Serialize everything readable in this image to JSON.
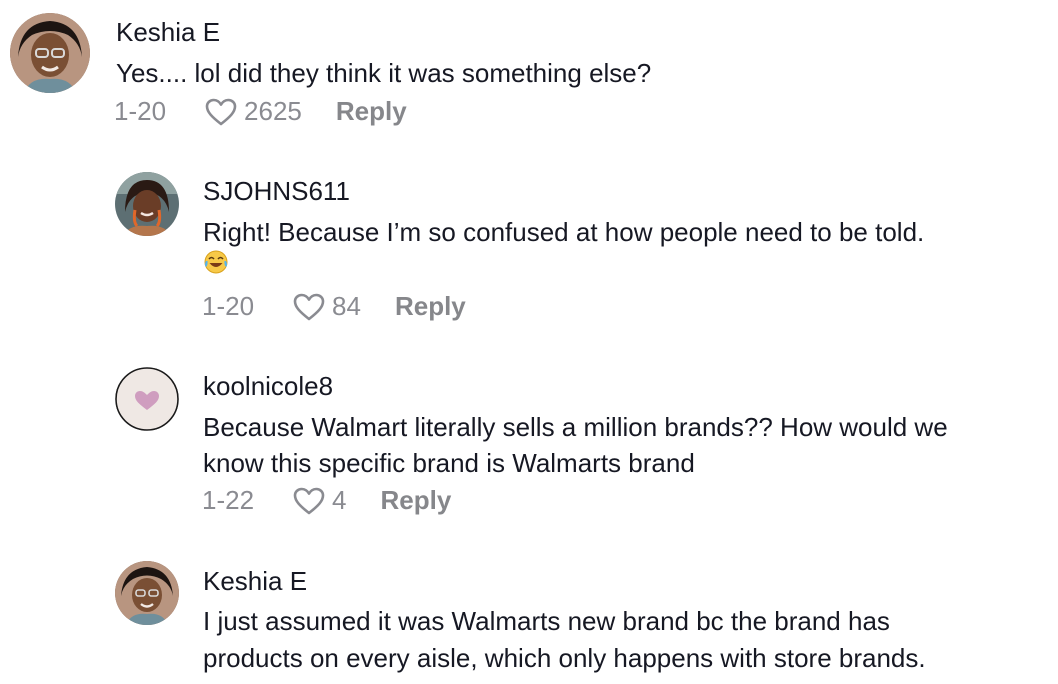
{
  "comments": [
    {
      "username": "Keshia E",
      "lines": [
        "Yes.... lol did they think it was something else?"
      ],
      "date": "1-20",
      "likes": "2625",
      "reply_label": "Reply",
      "avatar_icon": "user-photo-avatar"
    },
    {
      "username": "SJOHNS611",
      "lines": [
        "Right! Because I’m so confused at how people need to be told."
      ],
      "emoji": "😂",
      "date": "1-20",
      "likes": "84",
      "reply_label": "Reply",
      "avatar_icon": "user-photo-avatar"
    },
    {
      "username": "koolnicole8",
      "lines": [
        "Because Walmart literally sells a million brands?? How would we",
        "know this specific brand is Walmarts brand"
      ],
      "date": "1-22",
      "likes": "4",
      "reply_label": "Reply",
      "avatar_icon": "heart-avatar"
    },
    {
      "username": "Keshia E",
      "lines": [
        "I just assumed it was Walmarts new brand bc the brand has",
        "products on every aisle, which only happens with store brands."
      ],
      "avatar_icon": "user-photo-avatar"
    }
  ],
  "colors": {
    "text": "#161823",
    "meta": "#8a8b91",
    "heart_avatar": "#c98fb8"
  }
}
